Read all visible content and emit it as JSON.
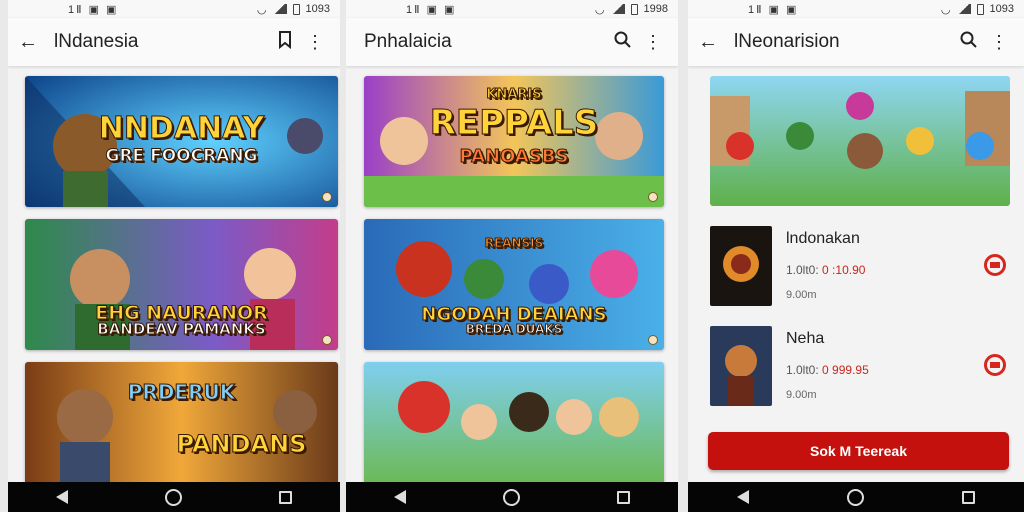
{
  "screen1": {
    "status_time": "1093",
    "status_left": "1Ⅱ ▣ ▣",
    "title": "lNdanesia",
    "banners": [
      {
        "title": "NNDANAY",
        "subtitle": "GRE FOOCRANG",
        "small": ""
      },
      {
        "title": "EHG NAURANOR",
        "subtitle": "BANDEAV PAMANKS",
        "small": ""
      },
      {
        "title": "PANDANS",
        "subtitle": "",
        "small": "PRDERUK"
      }
    ]
  },
  "screen2": {
    "status_time": "1998",
    "status_left": "1Ⅱ ▣ ▣",
    "title": "Pnhalaicia",
    "banners": [
      {
        "title": "REPPALS",
        "subtitle": "PANOASBS",
        "small": "KNARIS"
      },
      {
        "title": "NGODAH DEAIANS",
        "subtitle": "BREDA DUAKS",
        "small": "REANSIS"
      },
      {
        "title": "",
        "subtitle": "",
        "small": ""
      }
    ]
  },
  "screen3": {
    "status_time": "1093",
    "status_left": "1Ⅱ ▣ ▣",
    "title": "lNeonarision",
    "items": [
      {
        "name": "lndonakan",
        "meta_left": "1.0lt0:",
        "price": "0 :10.90",
        "size": "9.00m"
      },
      {
        "name": "Neha",
        "meta_left": "1.0lt0:",
        "price": "0 999.95",
        "size": "9.00m"
      }
    ],
    "cta_label": "Sok M Teereak"
  },
  "icons": {
    "back": "back-arrow-icon",
    "bookmark": "bookmark-icon",
    "search": "search-icon",
    "more": "more-vert-icon",
    "download": "download-icon"
  },
  "colors": {
    "accent": "#c4110d",
    "price": "#c8271d"
  }
}
